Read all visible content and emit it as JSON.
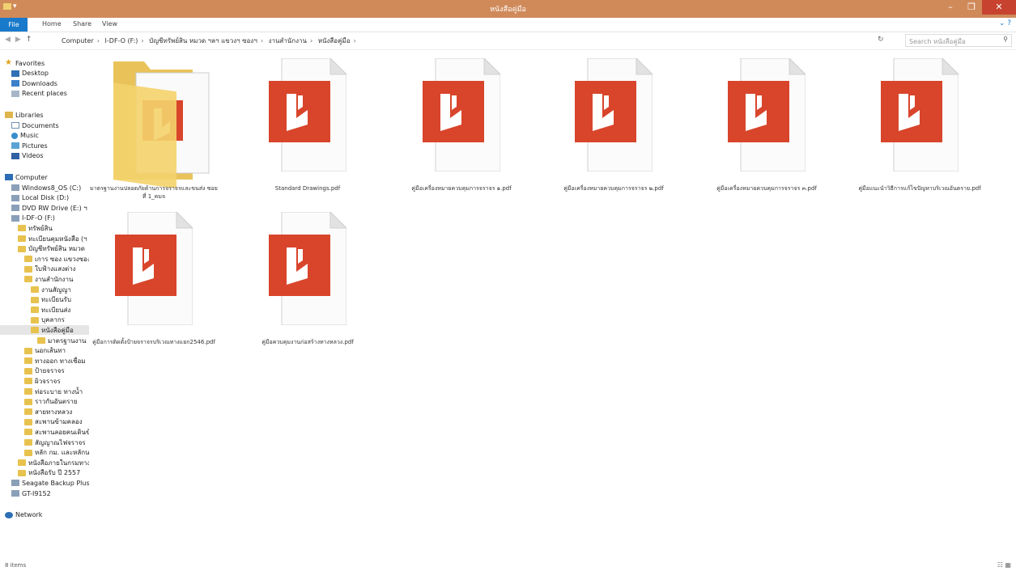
{
  "window": {
    "title": "หนังสือคู่มือ",
    "min": "–",
    "max": "❐",
    "close": "✕"
  },
  "ribbon": {
    "tabs": [
      "File",
      "Home",
      "Share",
      "View"
    ],
    "help": "⌄ ?"
  },
  "address": {
    "back": "◀",
    "forward": "▶",
    "up": "↑",
    "crumbs": [
      "Computer",
      "I-DF-O (F:)",
      "บัญชีทรัพย์สิน หมวด ฯลฯ แขวงฯ ซองฯ",
      "งานสำนักงาน",
      "หนังสือคู่มือ"
    ],
    "sep": "›",
    "refresh": "↻",
    "search_placeholder": "Search หนังสือคู่มือ",
    "search_icon": "⚲"
  },
  "sidebar": {
    "items": [
      {
        "label": "Favorites",
        "icon": "star-icon",
        "indent": 0
      },
      {
        "label": "Desktop",
        "icon": "desktop-icon",
        "indent": 1
      },
      {
        "label": "Downloads",
        "icon": "downloads-icon",
        "indent": 1
      },
      {
        "label": "Recent places",
        "icon": "recent-icon",
        "indent": 1
      },
      {
        "label": "Libraries",
        "icon": "library-icon",
        "indent": 0
      },
      {
        "label": "Documents",
        "icon": "documents-icon",
        "indent": 1
      },
      {
        "label": "Music",
        "icon": "music-icon",
        "indent": 1
      },
      {
        "label": "Pictures",
        "icon": "pictures-icon",
        "indent": 1
      },
      {
        "label": "Videos",
        "icon": "videos-icon",
        "indent": 1
      },
      {
        "label": "Computer",
        "icon": "computer-icon",
        "indent": 0
      },
      {
        "label": "Windows8_OS (C:)",
        "icon": "drive-icon",
        "indent": 1
      },
      {
        "label": "Local Disk (D:)",
        "icon": "drive-icon",
        "indent": 1
      },
      {
        "label": "DVD RW Drive (E:) ฯ",
        "icon": "dvd-icon",
        "indent": 1
      },
      {
        "label": "I-DF-O (F:)",
        "icon": "drive-icon",
        "indent": 1
      },
      {
        "label": "ทรัพย์สิน",
        "icon": "folder-icon",
        "indent": 2
      },
      {
        "label": "ทะเบียนคุมหนังสือ (ฯ",
        "icon": "folder-icon",
        "indent": 2
      },
      {
        "label": "บัญชีทรัพย์สิน หมวด",
        "icon": "folder-icon",
        "indent": 2
      },
      {
        "label": "เการ ซอง แขวงซองฯ",
        "icon": "folder-icon",
        "indent": 3
      },
      {
        "label": "ใบฟ้างแสงต่าง",
        "icon": "folder-icon",
        "indent": 3
      },
      {
        "label": "งานสำนักงาน",
        "icon": "folder-icon",
        "indent": 3
      },
      {
        "label": "งานสัญญา",
        "icon": "folder-icon",
        "indent": 4
      },
      {
        "label": "ทะเบียนรับ",
        "icon": "folder-icon",
        "indent": 4
      },
      {
        "label": "ทะเบียนส่ง",
        "icon": "folder-icon",
        "indent": 4
      },
      {
        "label": "บุคลากร",
        "icon": "folder-icon",
        "indent": 4
      },
      {
        "label": "หนังสือคู่มือ",
        "icon": "folder-icon",
        "indent": 4
      },
      {
        "label": "มาตรฐานงาน",
        "icon": "folder-icon",
        "indent": 5
      },
      {
        "label": "นอกเส้นทา",
        "icon": "folder-icon",
        "indent": 3
      },
      {
        "label": "ทางออก ทางเชื่อม",
        "icon": "folder-icon",
        "indent": 3
      },
      {
        "label": "ป้ายจราจร",
        "icon": "folder-icon",
        "indent": 3
      },
      {
        "label": "ผิวจราจร",
        "icon": "folder-icon",
        "indent": 3
      },
      {
        "label": "ท่อระบาย ทางน้ำ",
        "icon": "folder-icon",
        "indent": 3
      },
      {
        "label": "ราวกันอันตราย",
        "icon": "folder-icon",
        "indent": 3
      },
      {
        "label": "สายทางหลวง",
        "icon": "folder-icon",
        "indent": 3
      },
      {
        "label": "สะพานข้ามคลอง",
        "icon": "folder-icon",
        "indent": 3
      },
      {
        "label": "สะพานลอยคนเดินข้",
        "icon": "folder-icon",
        "indent": 3
      },
      {
        "label": "สัญญาณไฟจราจร",
        "icon": "folder-icon",
        "indent": 3
      },
      {
        "label": "หลัก กม. และหลักน",
        "icon": "folder-icon",
        "indent": 3
      },
      {
        "label": "หนังสือภายในกรมทาง",
        "icon": "folder-icon",
        "indent": 2
      },
      {
        "label": "หนังสือรับ ปี 2557",
        "icon": "folder-icon",
        "indent": 2
      },
      {
        "label": "Seagate Backup Plus",
        "icon": "drive-icon",
        "indent": 1
      },
      {
        "label": "GT-I9152",
        "icon": "phone-icon",
        "indent": 1
      },
      {
        "label": "Network",
        "icon": "network-icon",
        "indent": 0
      }
    ],
    "selected_index": 24
  },
  "files": [
    {
      "name": "มาตรฐานงานปลอดภัยด้านการจราจรและขนส่ง ซอยที่ 1_คมจ",
      "type": "folder"
    },
    {
      "name": "Standard Drawings.pdf",
      "type": "pdf"
    },
    {
      "name": "คู่มือเครื่องหมายควบคุมการจราจร ๑.pdf",
      "type": "pdf"
    },
    {
      "name": "คู่มือเครื่องหมายควบคุมการจราจร ๒.pdf",
      "type": "pdf"
    },
    {
      "name": "คู่มือเครื่องหมายควบคุมการจราจร ๓.pdf",
      "type": "pdf"
    },
    {
      "name": "คู่มือแนะนำวิธีการแก้ไขปัญหาบริเวณอันตราย.pdf",
      "type": "pdf"
    },
    {
      "name": "คู่มือการติดตั้งป้ายจราจรบริเวณทางแยก2546.pdf",
      "type": "pdf"
    },
    {
      "name": "คู่มือควบคุมงานก่อสร้างทางหลวง.pdf",
      "type": "pdf"
    }
  ],
  "status": {
    "count": "8 items",
    "views": "☷ ▦"
  },
  "colors": {
    "titlebar": "#d08a5a",
    "pdf_red": "#d8452b",
    "accent": "#1979ca"
  }
}
